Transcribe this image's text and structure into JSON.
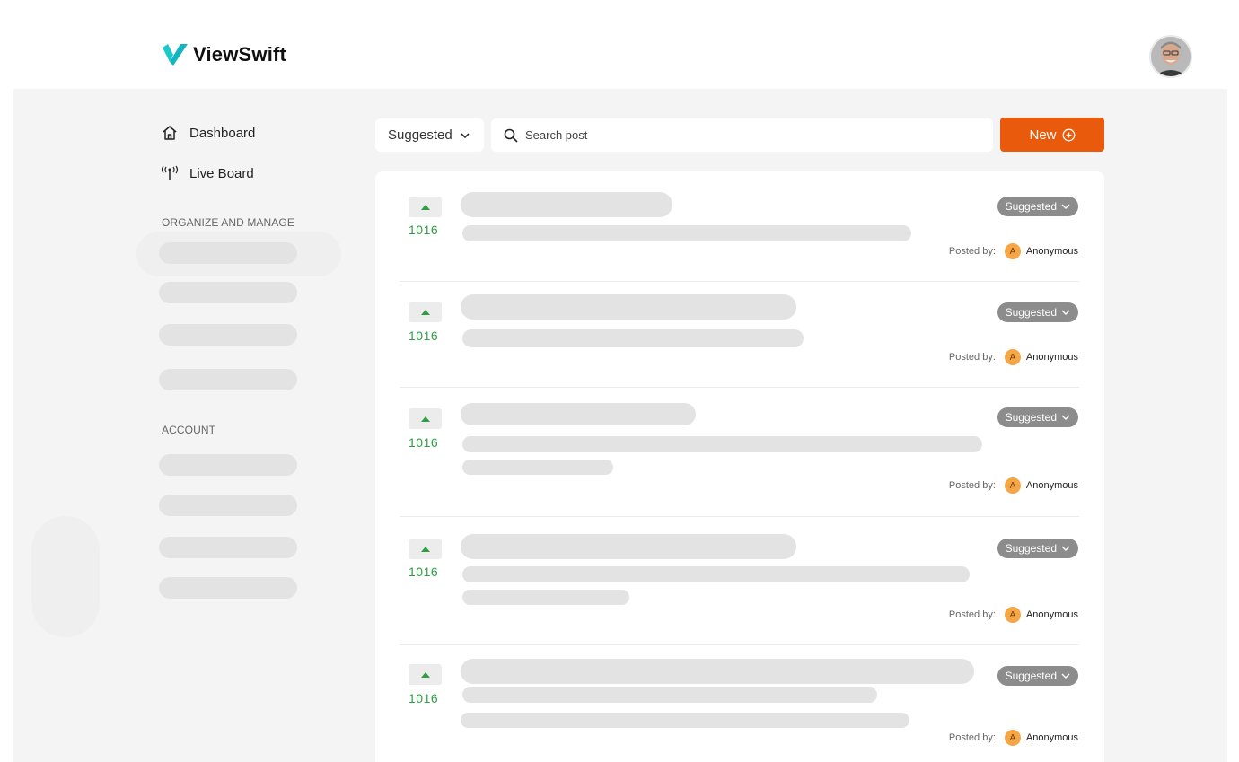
{
  "brand": {
    "name": "ViewSwift",
    "accent": "#1fc8c8"
  },
  "nav": {
    "items": [
      {
        "label": "Dashboard",
        "icon": "home-icon"
      },
      {
        "label": "Live Board",
        "icon": "broadcast-icon"
      }
    ],
    "sections": [
      {
        "label": "ORGANIZE AND MANAGE"
      },
      {
        "label": "ACCOUNT"
      }
    ]
  },
  "toolbar": {
    "sort_label": "Suggested",
    "search_placeholder": "Search post",
    "new_label": "New"
  },
  "colors": {
    "primary_button": "#ea5a0c",
    "vote_green": "#2f9e44",
    "status_badge": "#8c8c8c",
    "author_avatar": "#f5a646"
  },
  "posts": [
    {
      "votes": "1016",
      "status": "Suggested",
      "posted_by_label": "Posted by:",
      "author_initial": "A",
      "author": "Anonymous"
    },
    {
      "votes": "1016",
      "status": "Suggested",
      "posted_by_label": "Posted by:",
      "author_initial": "A",
      "author": "Anonymous"
    },
    {
      "votes": "1016",
      "status": "Suggested",
      "posted_by_label": "Posted by:",
      "author_initial": "A",
      "author": "Anonymous"
    },
    {
      "votes": "1016",
      "status": "Suggested",
      "posted_by_label": "Posted by:",
      "author_initial": "A",
      "author": "Anonymous"
    },
    {
      "votes": "1016",
      "status": "Suggested",
      "posted_by_label": "Posted by:",
      "author_initial": "A",
      "author": "Anonymous"
    }
  ]
}
